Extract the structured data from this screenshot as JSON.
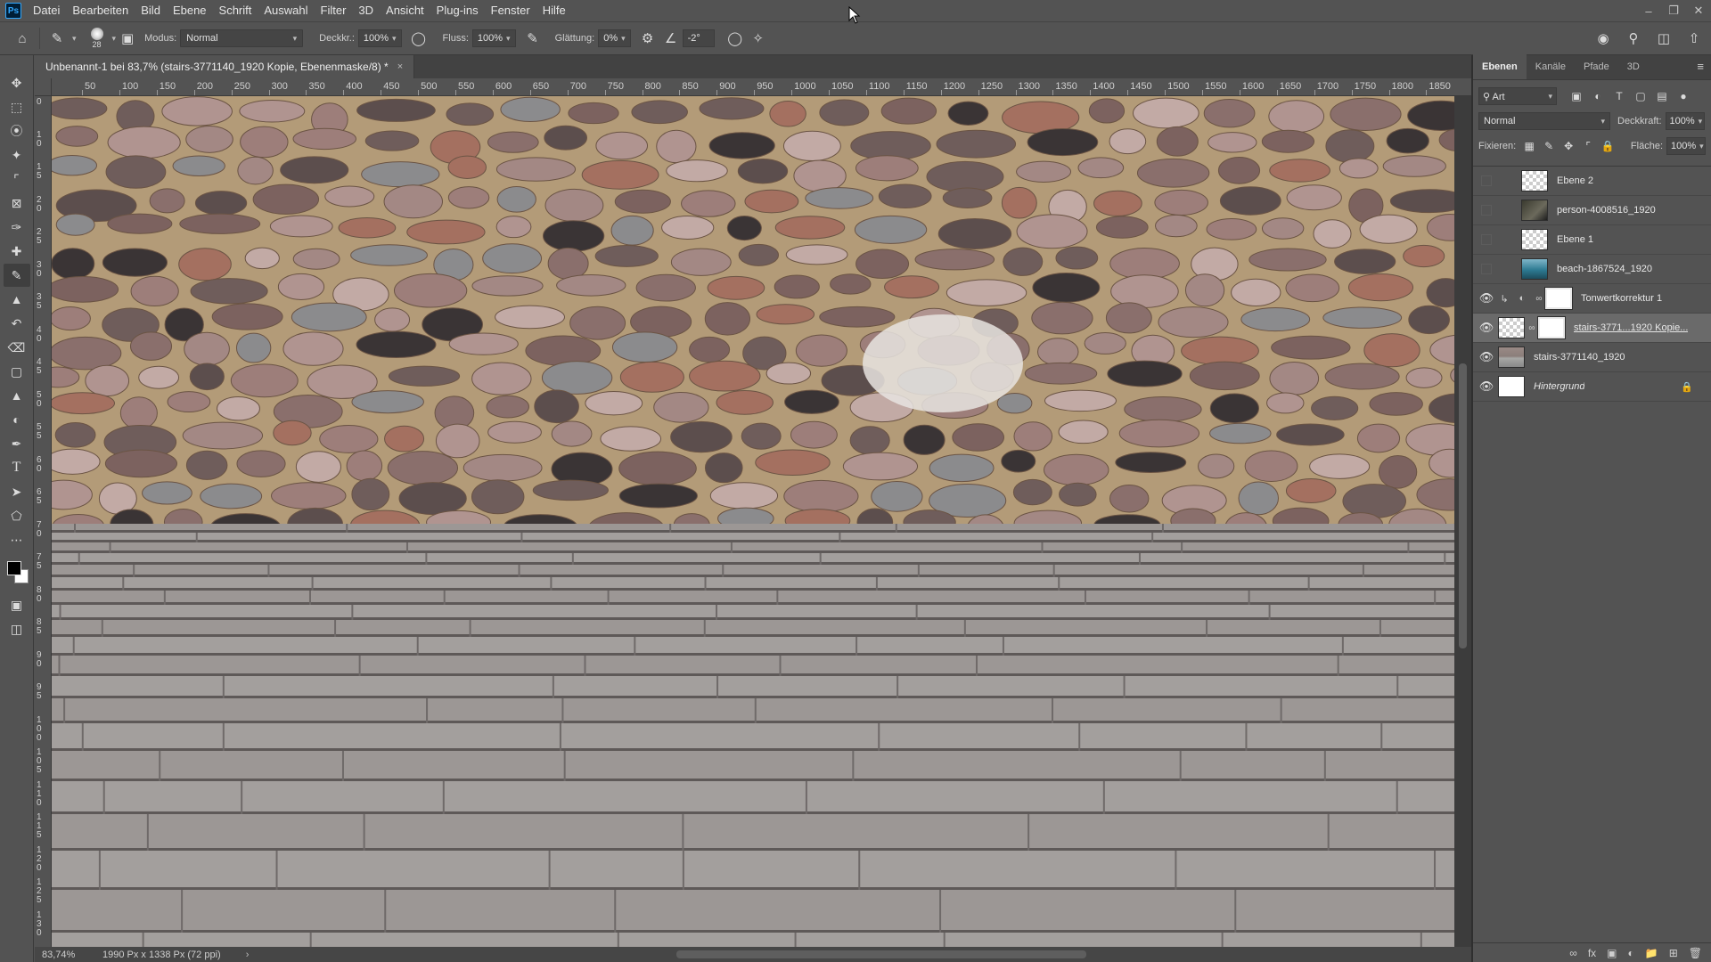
{
  "menu": {
    "app_icon": "Ps",
    "items": [
      "Datei",
      "Bearbeiten",
      "Bild",
      "Ebene",
      "Schrift",
      "Auswahl",
      "Filter",
      "3D",
      "Ansicht",
      "Plug-ins",
      "Fenster",
      "Hilfe"
    ]
  },
  "options": {
    "brush_size": "28",
    "mode_label": "Modus:",
    "mode_value": "Normal",
    "opacity_label": "Deckkr.:",
    "opacity_value": "100%",
    "flow_label": "Fluss:",
    "flow_value": "100%",
    "smoothing_label": "Glättung:",
    "smoothing_value": "0%",
    "angle_value": "-2°"
  },
  "document": {
    "tab_title": "Unbenannt-1 bei 83,7% (stairs-3771140_1920 Kopie, Ebenenmaske/8) *",
    "close_icon": "×",
    "ruler_top": [
      "50",
      "100",
      "150",
      "200",
      "250",
      "300",
      "350",
      "400",
      "450",
      "500",
      "550",
      "600",
      "650",
      "700",
      "750",
      "800",
      "850",
      "900",
      "950",
      "1000",
      "1050",
      "1100",
      "1150",
      "1200",
      "1250",
      "1300",
      "1350",
      "1400",
      "1450",
      "1500",
      "1550",
      "1600",
      "1650",
      "1700",
      "1750",
      "1800",
      "1850"
    ],
    "ruler_left": [
      "0",
      "1 0",
      "1 5",
      "2 0",
      "2 5",
      "3 0",
      "3 5",
      "4 0",
      "4 5",
      "5 0",
      "5 5",
      "6 0",
      "6 5",
      "7 0",
      "7 5",
      "8 0",
      "8 5",
      "9 0",
      "9 5",
      "1 0 0",
      "1 0 5",
      "1 1 0",
      "1 1 5",
      "1 2 0",
      "1 2 5",
      "1 3 0"
    ]
  },
  "status": {
    "zoom": "83,74%",
    "doc_info": "1990 Px x 1338 Px (72 ppi)",
    "arrow": "›"
  },
  "panels": {
    "tabs": [
      "Ebenen",
      "Kanäle",
      "Pfade",
      "3D"
    ],
    "active_tab": "Ebenen",
    "filter_kind": "Art",
    "blend_mode": "Normal",
    "opacity_label": "Deckkraft:",
    "opacity_value": "100%",
    "lock_label": "Fixieren:",
    "fill_label": "Fläche:",
    "fill_value": "100%",
    "layers": [
      {
        "name": "Ebene 2",
        "visible": false,
        "thumb": "checker"
      },
      {
        "name": "person-4008516_1920",
        "visible": false,
        "thumb": "dark"
      },
      {
        "name": "Ebene 1",
        "visible": false,
        "thumb": "checker"
      },
      {
        "name": "beach-1867524_1920",
        "visible": false,
        "thumb": "beach"
      },
      {
        "name": "Tonwertkorrektur 1",
        "visible": true,
        "thumb": "adjust"
      },
      {
        "name": "stairs-3771...1920 Kopie...",
        "visible": true,
        "thumb": "stairs-mask",
        "selected": true
      },
      {
        "name": "stairs-3771140_1920",
        "visible": true,
        "thumb": "stairs"
      },
      {
        "name": "Hintergrund",
        "visible": true,
        "thumb": "white",
        "locked": true
      }
    ]
  }
}
